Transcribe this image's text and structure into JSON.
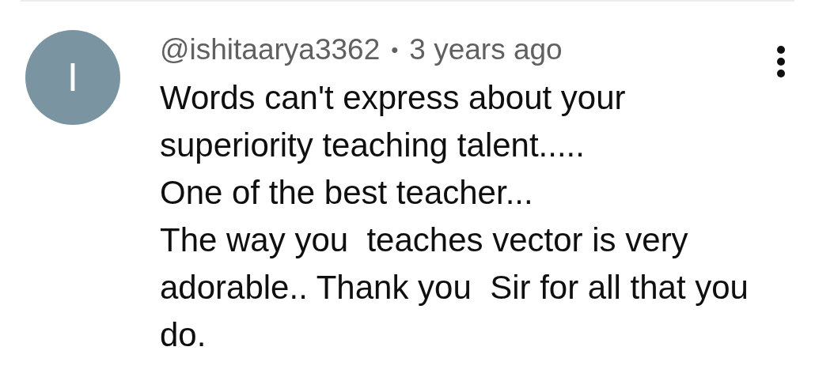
{
  "comment": {
    "avatar_letter": "I",
    "author": "@ishitaarya3362",
    "separator": "•",
    "time": "3 years ago",
    "lines": [
      "Words can't express about your",
      "superiority teaching talent.....",
      "One of the best teacher...",
      "The way you  teaches vector is very",
      "adorable.. Thank you  Sir for all that you",
      "do."
    ]
  }
}
